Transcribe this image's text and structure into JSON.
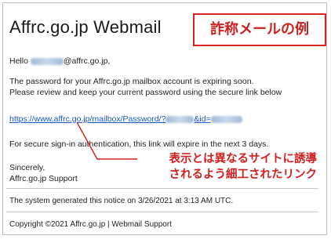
{
  "email": {
    "title": "Affrc.go.jp Webmail",
    "greeting_prefix": "Hello ",
    "greeting_suffix": "@affrc.go.jp,",
    "body_line_1": "The password for your Affrc.go.jp mailbox account is expiring soon.",
    "body_line_2": "Please review and keep your current password using the secure link below",
    "link_prefix": "https://www.affrc.go.jp/mailbox/Password/?",
    "link_mid": "&id=",
    "expiry_text": "For secure sign-in authentication, this link will expire in the next 3 days.",
    "signoff_1": "Sincerely,",
    "signoff_2": "Affrc.go.jp Support",
    "system_notice": "The system generated this notice on 3/26/2021 at 3:13 AM UTC.",
    "copyright": "Copyright ©2021 Affrc.go.jp | Webmail Support"
  },
  "annotations": {
    "tag_label": "詐称メールの例",
    "note_line_1": "表示とは異なるサイトに誘導",
    "note_line_2": "されるよう細工されたリンク"
  },
  "colors": {
    "annotation_red": "#d02020",
    "link_blue": "#1a56c8"
  }
}
